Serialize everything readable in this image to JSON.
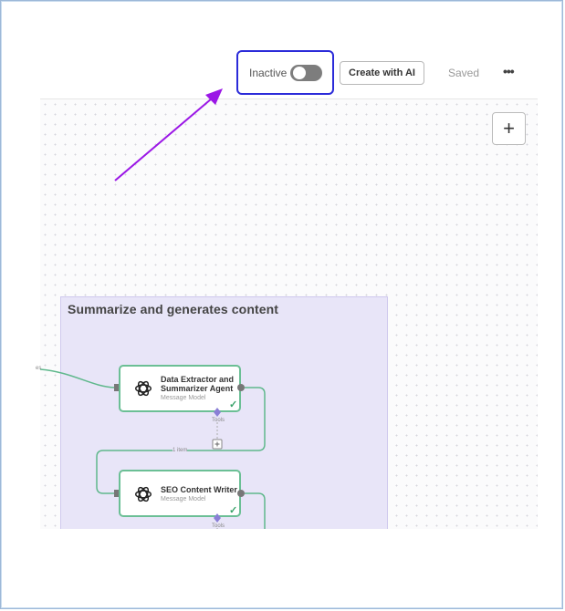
{
  "toolbar": {
    "toggle_label": "Inactive",
    "create_button": "Create with AI",
    "saved_status": "Saved",
    "more_label": "•••"
  },
  "canvas": {
    "zoom_in_label": "+",
    "sticky_note": {
      "title": "Summarize and generates content"
    },
    "nodes": [
      {
        "title_line1": "Data Extractor and",
        "title_line2": "Summarizer Agent",
        "subtitle": "Message Model",
        "icon": "openai-icon",
        "tools_label": "Tools",
        "add_label": "+"
      },
      {
        "title_line1": "SEO Content Writer",
        "subtitle": "Message Model",
        "icon": "openai-icon",
        "tools_label": "Tools"
      }
    ],
    "connection_labels": {
      "incoming": "es",
      "between": "1 item"
    }
  },
  "colors": {
    "highlight_border": "#2b2bd9",
    "arrow": "#9b17e6",
    "node_border": "#6bbf95",
    "sticky_bg": "#e8e5f8",
    "toggle_off": "#7d7d7d"
  }
}
